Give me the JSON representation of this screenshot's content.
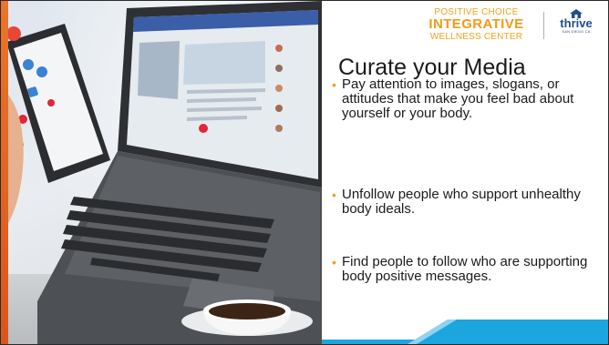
{
  "logo": {
    "line1": "POSITIVE CHOICE",
    "line2": "INTEGRATIVE",
    "line3": "WELLNESS CENTER",
    "brand": "thrive",
    "brand_tagline": "SAN DIEGO CA"
  },
  "slide": {
    "title": "Curate your Media",
    "bullets": [
      "Pay attention to images, slogans, or attitudes that make you feel bad about yourself or your body.",
      "Unfollow people who support unhealthy body ideals.",
      "Find people to follow who are supporting body positive messages."
    ]
  },
  "colors": {
    "accent_orange": "#f0a01e",
    "accent_blue": "#1ca6e0",
    "brand_blue": "#1f4e8a",
    "strip_orange": "#e9762b"
  },
  "photo": {
    "description_icon": "laptop-phone-coffee-photo"
  }
}
